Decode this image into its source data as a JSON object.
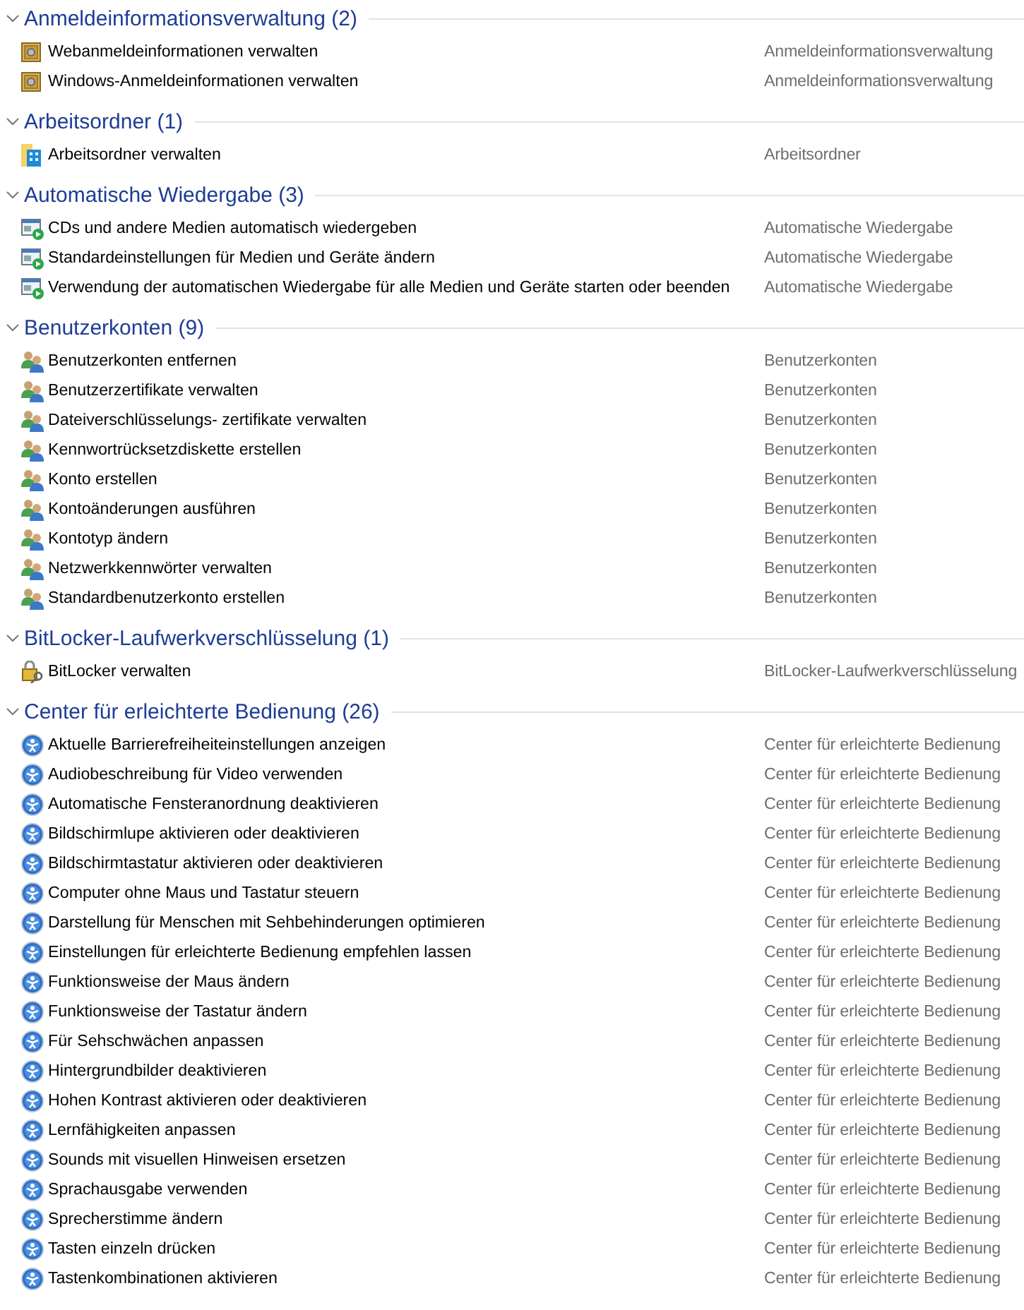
{
  "groups": [
    {
      "title": "Anmeldeinformationsverwaltung (2)",
      "kind": "credentials",
      "expanded": true,
      "items": [
        {
          "label": "Webanmeldeinformationen verwalten",
          "category": "Anmeldeinformationsverwaltung"
        },
        {
          "label": "Windows-Anmeldeinformationen verwalten",
          "category": "Anmeldeinformationsverwaltung"
        }
      ]
    },
    {
      "title": "Arbeitsordner (1)",
      "kind": "workfolders",
      "expanded": true,
      "items": [
        {
          "label": "Arbeitsordner verwalten",
          "category": "Arbeitsordner"
        }
      ]
    },
    {
      "title": "Automatische Wiedergabe (3)",
      "kind": "autoplay",
      "expanded": true,
      "items": [
        {
          "label": "CDs und andere Medien automatisch wiedergeben",
          "category": "Automatische Wiedergabe"
        },
        {
          "label": "Standardeinstellungen für Medien und Geräte ändern",
          "category": "Automatische Wiedergabe"
        },
        {
          "label": "Verwendung der automatischen Wiedergabe für alle Medien und Geräte starten oder beenden",
          "category": "Automatische Wiedergabe"
        }
      ]
    },
    {
      "title": "Benutzerkonten (9)",
      "kind": "users",
      "expanded": true,
      "items": [
        {
          "label": "Benutzerkonten entfernen",
          "category": "Benutzerkonten"
        },
        {
          "label": "Benutzerzertifikate verwalten",
          "category": "Benutzerkonten"
        },
        {
          "label": "Dateiverschlüsselungs- zertifikate verwalten",
          "category": "Benutzerkonten"
        },
        {
          "label": "Kennwortrücksetzdiskette erstellen",
          "category": "Benutzerkonten"
        },
        {
          "label": "Konto erstellen",
          "category": "Benutzerkonten"
        },
        {
          "label": "Kontoänderungen ausführen",
          "category": "Benutzerkonten"
        },
        {
          "label": "Kontotyp ändern",
          "category": "Benutzerkonten"
        },
        {
          "label": "Netzwerkkennwörter verwalten",
          "category": "Benutzerkonten"
        },
        {
          "label": "Standardbenutzerkonto erstellen",
          "category": "Benutzerkonten"
        }
      ]
    },
    {
      "title": "BitLocker-Laufwerkverschlüsselung (1)",
      "kind": "bitlocker",
      "expanded": true,
      "items": [
        {
          "label": "BitLocker verwalten",
          "category": "BitLocker-Laufwerkverschlüsselung"
        }
      ]
    },
    {
      "title": "Center für erleichterte Bedienung (26)",
      "kind": "ease",
      "expanded": true,
      "items": [
        {
          "label": "Aktuelle Barrierefreiheiteinstellungen anzeigen",
          "category": "Center für erleichterte Bedienung"
        },
        {
          "label": "Audiobeschreibung für Video verwenden",
          "category": "Center für erleichterte Bedienung"
        },
        {
          "label": "Automatische Fensteranordnung deaktivieren",
          "category": "Center für erleichterte Bedienung"
        },
        {
          "label": "Bildschirmlupe aktivieren oder deaktivieren",
          "category": "Center für erleichterte Bedienung"
        },
        {
          "label": "Bildschirmtastatur aktivieren oder deaktivieren",
          "category": "Center für erleichterte Bedienung"
        },
        {
          "label": "Computer ohne Maus und Tastatur steuern",
          "category": "Center für erleichterte Bedienung"
        },
        {
          "label": "Darstellung für Menschen mit Sehbehinderungen optimieren",
          "category": "Center für erleichterte Bedienung"
        },
        {
          "label": "Einstellungen für erleichterte Bedienung empfehlen lassen",
          "category": "Center für erleichterte Bedienung"
        },
        {
          "label": "Funktionsweise der Maus ändern",
          "category": "Center für erleichterte Bedienung"
        },
        {
          "label": "Funktionsweise der Tastatur ändern",
          "category": "Center für erleichterte Bedienung"
        },
        {
          "label": "Für Sehschwächen anpassen",
          "category": "Center für erleichterte Bedienung"
        },
        {
          "label": "Hintergrundbilder deaktivieren",
          "category": "Center für erleichterte Bedienung"
        },
        {
          "label": "Hohen Kontrast aktivieren oder deaktivieren",
          "category": "Center für erleichterte Bedienung"
        },
        {
          "label": "Lernfähigkeiten anpassen",
          "category": "Center für erleichterte Bedienung"
        },
        {
          "label": "Sounds mit visuellen Hinweisen ersetzen",
          "category": "Center für erleichterte Bedienung"
        },
        {
          "label": "Sprachausgabe verwenden",
          "category": "Center für erleichterte Bedienung"
        },
        {
          "label": "Sprecherstimme ändern",
          "category": "Center für erleichterte Bedienung"
        },
        {
          "label": "Tasten einzeln drücken",
          "category": "Center für erleichterte Bedienung"
        },
        {
          "label": "Tastenkombinationen aktivieren",
          "category": "Center für erleichterte Bedienung"
        }
      ]
    }
  ]
}
